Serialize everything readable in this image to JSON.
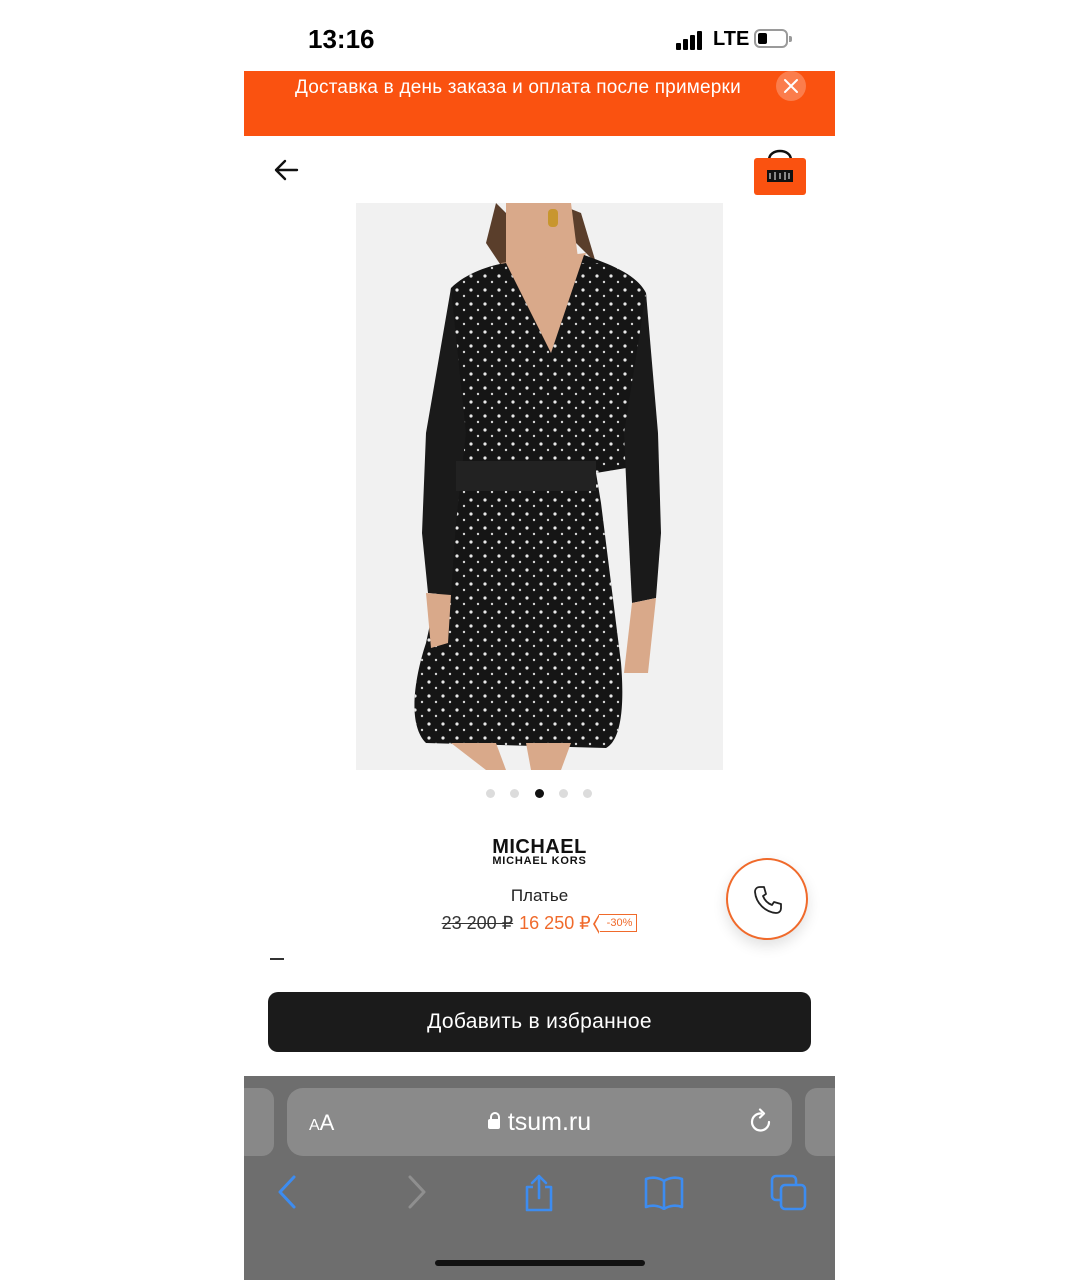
{
  "status_bar": {
    "time": "13:16",
    "network": "LTE"
  },
  "banner": {
    "text": "Доставка в день заказа и оплата после примерки"
  },
  "header": {
    "bag_logo_text": "ЦУМ"
  },
  "gallery": {
    "total": 5,
    "active_index": 2
  },
  "product": {
    "brand_line1": "MICHAEL",
    "brand_line2": "MICHAEL KORS",
    "name": "Платье",
    "old_price": "23 200 ₽",
    "new_price": "16 250 ₽",
    "discount": "-30%"
  },
  "actions": {
    "favorite_label": "Добавить в избранное"
  },
  "browser": {
    "aa_label_small": "A",
    "aa_label_big": "A",
    "url": "tsum.ru"
  },
  "colors": {
    "accent": "#fa5210",
    "price": "#f06a2b",
    "button_dark": "#1b1b1b",
    "safari_blue": "#3d8cf0"
  },
  "icons": [
    "back-arrow-icon",
    "shopping-bag-icon",
    "close-icon",
    "phone-icon",
    "lock-icon",
    "reload-icon",
    "back-icon",
    "forward-icon",
    "share-icon",
    "bookmarks-icon",
    "tabs-icon"
  ]
}
